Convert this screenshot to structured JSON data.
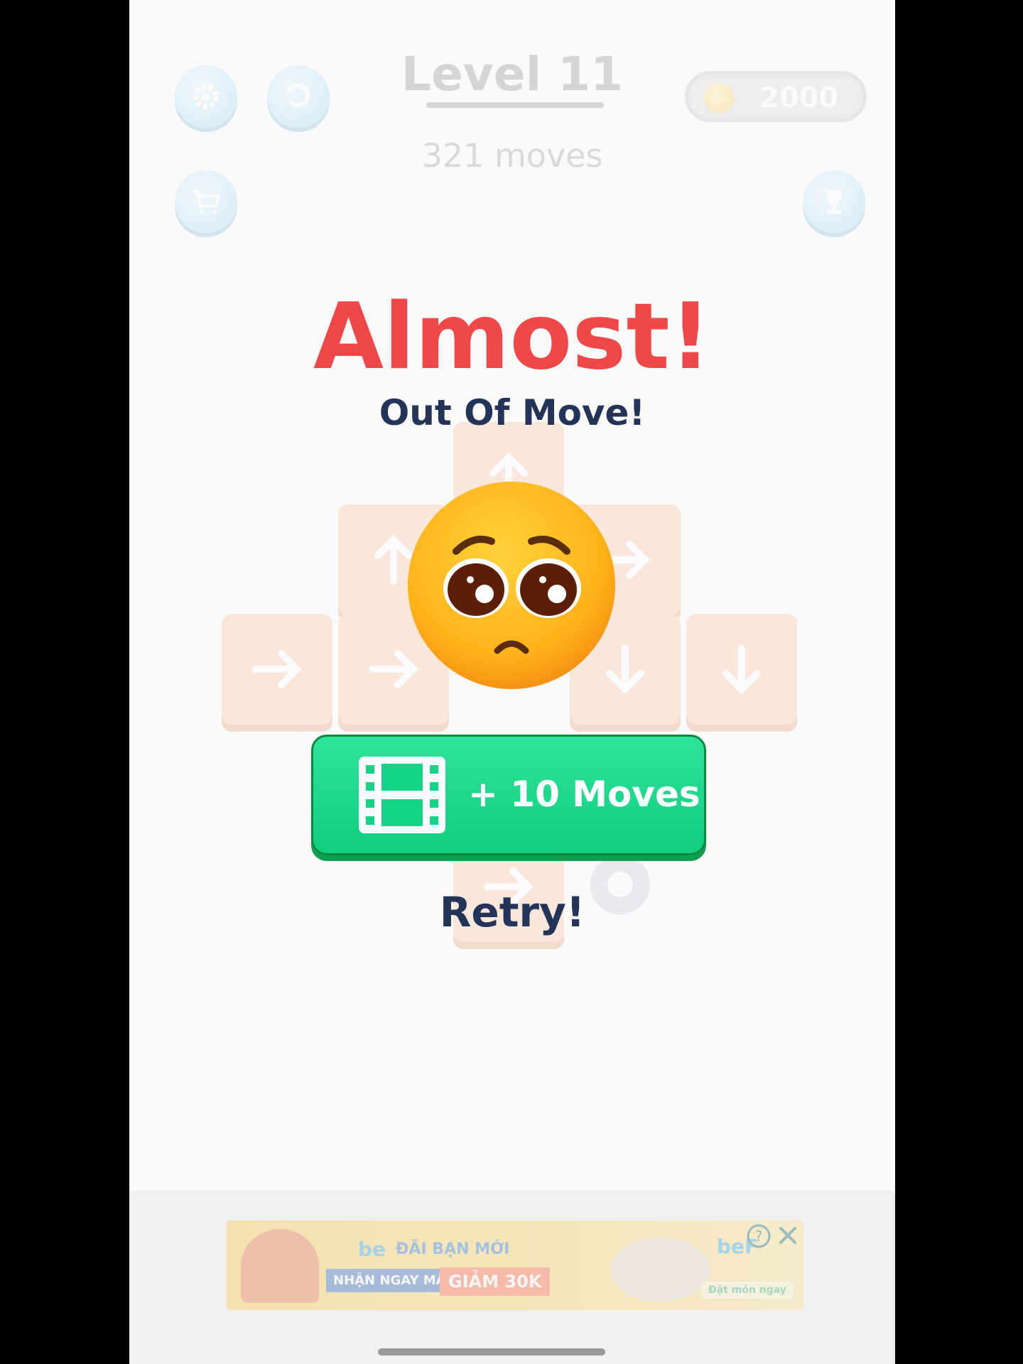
{
  "header": {
    "level_title": "Level 11",
    "moves_count": "321 moves",
    "coins": "2000"
  },
  "board": {
    "tiles": [
      {
        "direction": "up"
      },
      {
        "direction": "up"
      },
      {
        "direction": "right"
      },
      {
        "direction": "right"
      },
      {
        "direction": "right"
      },
      {
        "direction": "down"
      },
      {
        "direction": "down"
      },
      {
        "direction": "right"
      }
    ]
  },
  "dialog": {
    "headline": "Almost!",
    "subheadline": "Out Of Move!",
    "emoji": "pleading-face",
    "extra_moves_label": "+ 10 Moves",
    "retry_label": "Retry!"
  },
  "banner_ad": {
    "brand": "be",
    "tagline": "ĐÃI BẠN MỚI",
    "cta_1": "NHẬN NGAY MÃ",
    "cta_2": "GIẢM 30K",
    "brand_2": "beF",
    "order_label": "Đặt món ngay"
  },
  "colors": {
    "headline": "#f04848",
    "subtext": "#243358",
    "button_green": "#1fd98c",
    "tile_orange": "#f7b98c"
  }
}
